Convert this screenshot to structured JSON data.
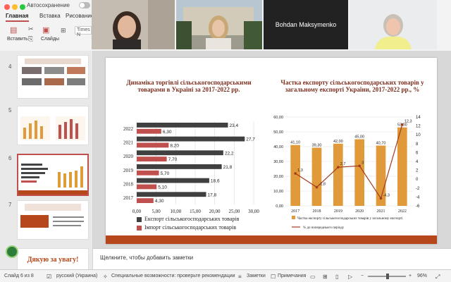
{
  "ribbon": {
    "autosave_label": "Автосохранение",
    "tabs": [
      "Главная",
      "Вставка",
      "Рисование"
    ],
    "paste_label": "Вставить",
    "slides_label": "Слайды",
    "font_name": "Times N"
  },
  "meeting": {
    "participant_name": "Bohdan Maksymenko"
  },
  "thumbnails": [
    {
      "num": "4"
    },
    {
      "num": "5"
    },
    {
      "num": "6"
    },
    {
      "num": "7"
    },
    {
      "num": "8",
      "text": "Дякую за увагу!"
    }
  ],
  "slide": {
    "left_title": "Динаміка торгівлі сільськогосподарськими товарами в Україні за 2017-2022 рр.",
    "right_title": "Частка експорту сільськогосподарських товарів у загальному експорті України, 2017-2022 рр., %"
  },
  "chart_data": [
    {
      "type": "bar",
      "orientation": "horizontal",
      "categories": [
        "2017",
        "2018",
        "2019",
        "2020",
        "2021",
        "2022"
      ],
      "series": [
        {
          "name": "Експорт сільськогосподарських товарів",
          "values": [
            17.8,
            18.6,
            21.8,
            22.2,
            27.7,
            23.4
          ],
          "labels": [
            "17,8",
            "18,6",
            "21,8",
            "22,2",
            "27,7",
            "23,4"
          ],
          "color": "#404040"
        },
        {
          "name": "Імпорт сільськогосподарських товарів",
          "values": [
            4.3,
            5.1,
            5.7,
            7.7,
            8.2,
            6.3
          ],
          "labels": [
            "4,30",
            "5,10",
            "5,70",
            "7,70",
            "8,20",
            "6,30"
          ],
          "color": "#c0504d"
        }
      ],
      "xlim": [
        0,
        30
      ],
      "xticks": [
        "0,00",
        "5,00",
        "10,00",
        "15,00",
        "20,00",
        "25,00",
        "30,00"
      ],
      "grid": true,
      "legend": "bottom"
    },
    {
      "type": "bar",
      "categories": [
        "2017",
        "2018",
        "2019",
        "2020",
        "2021",
        "2022"
      ],
      "series": [
        {
          "name": "Частка експорту сільськогосподарських товарів у загальному експорті",
          "values": [
            41.1,
            39.3,
            42.0,
            45.0,
            40.7,
            53.0
          ],
          "labels": [
            "41,10",
            "39,30",
            "42,00",
            "45,00",
            "40,70",
            "53,00"
          ],
          "color": "#e09a3a",
          "axis": "left"
        },
        {
          "name": "% до попереднього періоду",
          "type": "line",
          "values": [
            1.3,
            -1.8,
            2.7,
            3.0,
            -4.3,
            12.3
          ],
          "labels": [
            "1,3",
            "-1,8",
            "2,7",
            "3",
            "-4,3",
            "12,3"
          ],
          "color": "#a33b1e",
          "axis": "right"
        }
      ],
      "ylim_left": [
        0,
        60
      ],
      "yticks_left": [
        "0,00",
        "10,00",
        "20,00",
        "30,00",
        "40,00",
        "50,00",
        "60,00"
      ],
      "ylim_right": [
        -6,
        14
      ],
      "yticks_right": [
        "-6",
        "-4",
        "-2",
        "0",
        "2",
        "4",
        "6",
        "8",
        "10",
        "12",
        "14"
      ],
      "grid": true,
      "legend": "bottom"
    }
  ],
  "notes": {
    "placeholder": "Щелкните, чтобы добавить заметки"
  },
  "status": {
    "slide_info": "Слайд 6 из 8",
    "language": "русский (Украина)",
    "accessibility": "Специальные возможности: проверьте рекомендации",
    "notes_btn": "Заметки",
    "comments_btn": "Примечания",
    "zoom": "96%"
  }
}
